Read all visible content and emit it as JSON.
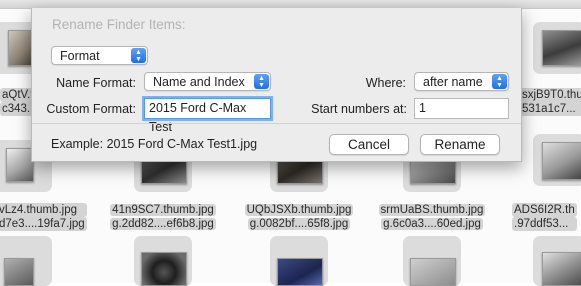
{
  "dialog": {
    "title": "Rename Finder Items:",
    "mode": "Format",
    "name_format_label": "Name Format:",
    "name_format_value": "Name and Index",
    "where_label": "Where:",
    "where_value": "after name",
    "custom_format_label": "Custom Format:",
    "custom_format_value": "2015 Ford C-Max Test",
    "start_numbers_label": "Start numbers at:",
    "start_numbers_value": "1",
    "example": "Example: 2015 Ford C-Max Test1.jpg",
    "cancel_label": "Cancel",
    "rename_label": "Rename"
  },
  "background": {
    "partial_names_top": [
      {
        "line1": "aQtV.t",
        "line2": "c343."
      },
      {
        "line1": "sxjB9T0.thu",
        "line2": "531a1c7..."
      }
    ],
    "files": [
      {
        "line1": "vLz4.thumb.jpg",
        "line2": "d7e3....19fa7.jpg"
      },
      {
        "line1": "41n9SC7.thumb.jpg",
        "line2": "g.2dd82....ef6b8.jpg"
      },
      {
        "line1": "UQbJSXb.thumb.jpg",
        "line2": "g.0082bf....65f8.jpg"
      },
      {
        "line1": "srmUaBS.thumb.jpg",
        "line2": "g.6c0a3....60ed.jpg"
      },
      {
        "line1": "ADS6I2R.th",
        "line2": ".97ddf53..."
      }
    ]
  }
}
